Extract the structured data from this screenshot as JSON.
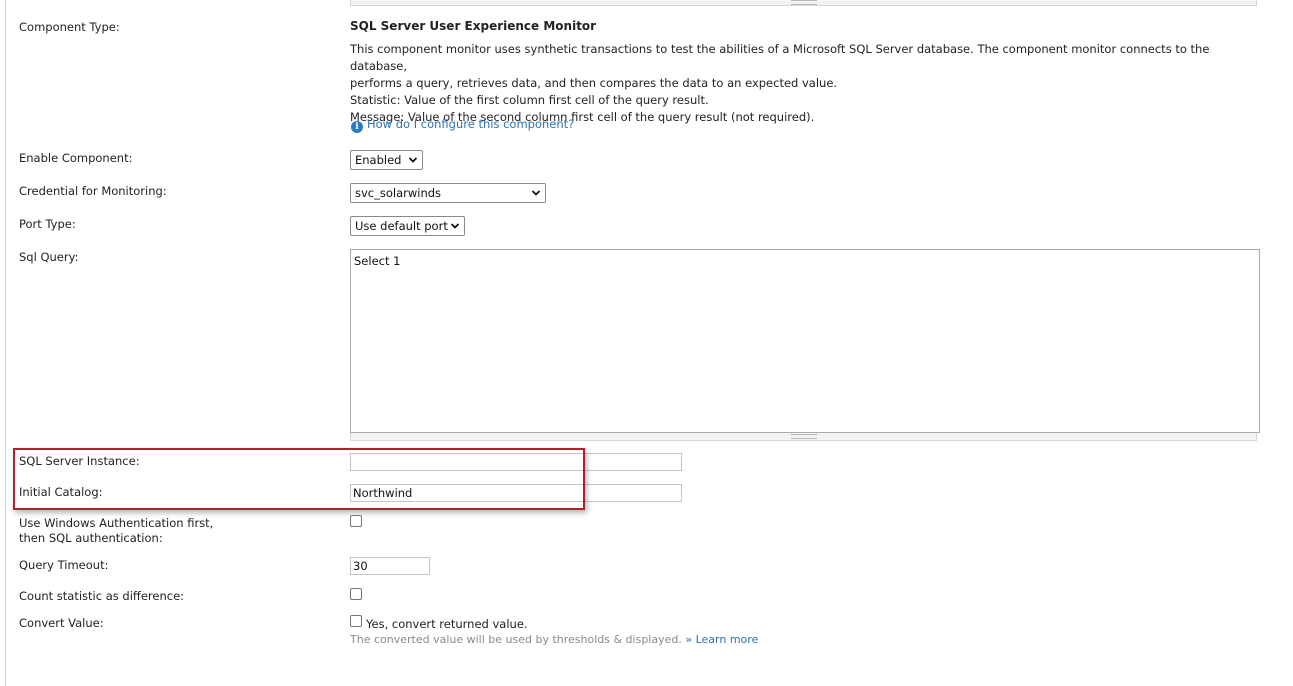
{
  "component": {
    "type_label": "Component Type:",
    "title": "SQL Server User Experience Monitor",
    "description": [
      "This component monitor uses synthetic transactions to test the abilities of a Microsoft SQL Server database. The component monitor connects to the database,",
      "performs a query, retrieves data, and then compares the data to an expected value.",
      "Statistic: Value of the first column first cell of the query result.",
      "Message: Value of the second column first cell of the query result (not required)."
    ],
    "help_link": "How do I configure this component?"
  },
  "fields": {
    "enable_component": {
      "label": "Enable Component:",
      "value": "Enabled"
    },
    "credential": {
      "label": "Credential for Monitoring:",
      "value": "svc_solarwinds"
    },
    "port_type": {
      "label": "Port Type:",
      "value": "Use default port"
    },
    "sql_query": {
      "label": "Sql Query:",
      "value": "Select 1"
    },
    "sql_server_instance": {
      "label": "SQL Server Instance:",
      "value": ""
    },
    "initial_catalog": {
      "label": "Initial Catalog:",
      "value": "Northwind"
    },
    "windows_auth": {
      "label_line1": "Use Windows Authentication first,",
      "label_line2": "then SQL authentication:",
      "checked": false
    },
    "query_timeout": {
      "label": "Query Timeout:",
      "value": "30"
    },
    "count_difference": {
      "label": "Count statistic as difference:",
      "checked": false
    },
    "convert_value": {
      "label": "Convert Value:",
      "checkbox_text": "Yes, convert returned value.",
      "note": "The converted value will be used by thresholds & displayed.",
      "learn_more": "» Learn more",
      "checked": false
    }
  },
  "colors": {
    "link": "#2b73b5",
    "highlight_border": "#b2202a"
  },
  "icons": {
    "help": "info-icon",
    "dropdown": "chevron-down-icon"
  }
}
